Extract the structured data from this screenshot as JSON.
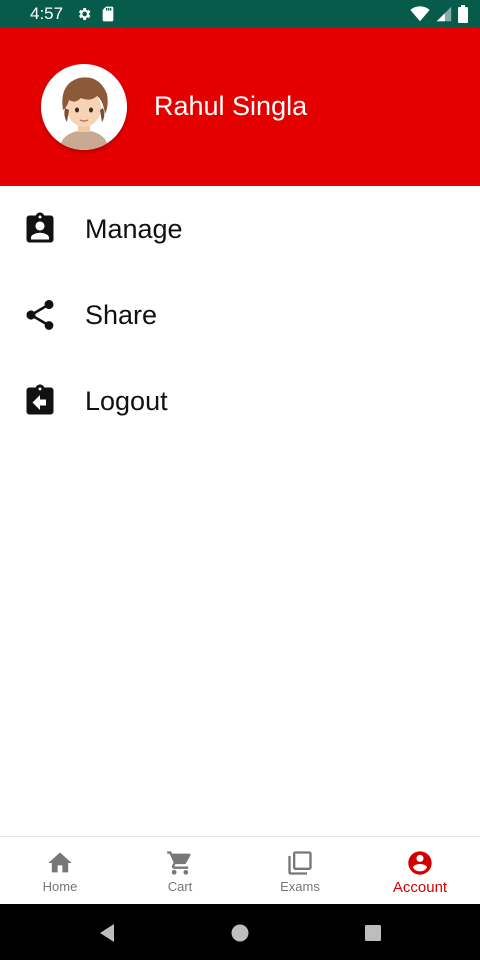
{
  "status_bar": {
    "time": "4:57",
    "icons": [
      "gear-icon",
      "sd-card-icon",
      "wifi-icon",
      "signal-icon",
      "battery-icon"
    ]
  },
  "profile": {
    "name": "Rahul Singla",
    "header_color": "#e50000"
  },
  "menu": {
    "items": [
      {
        "label": "Manage",
        "icon": "assignment-ind-icon"
      },
      {
        "label": "Share",
        "icon": "share-icon"
      },
      {
        "label": "Logout",
        "icon": "assignment-return-icon"
      }
    ]
  },
  "bottom_nav": {
    "active": "Account",
    "active_color": "#d40000",
    "items": [
      {
        "label": "Home",
        "icon": "home-icon"
      },
      {
        "label": "Cart",
        "icon": "cart-icon"
      },
      {
        "label": "Exams",
        "icon": "library-icon"
      },
      {
        "label": "Account",
        "icon": "account-circle-icon"
      }
    ]
  },
  "system_nav": {
    "buttons": [
      "back-icon",
      "home-circle-icon",
      "recents-icon"
    ]
  }
}
